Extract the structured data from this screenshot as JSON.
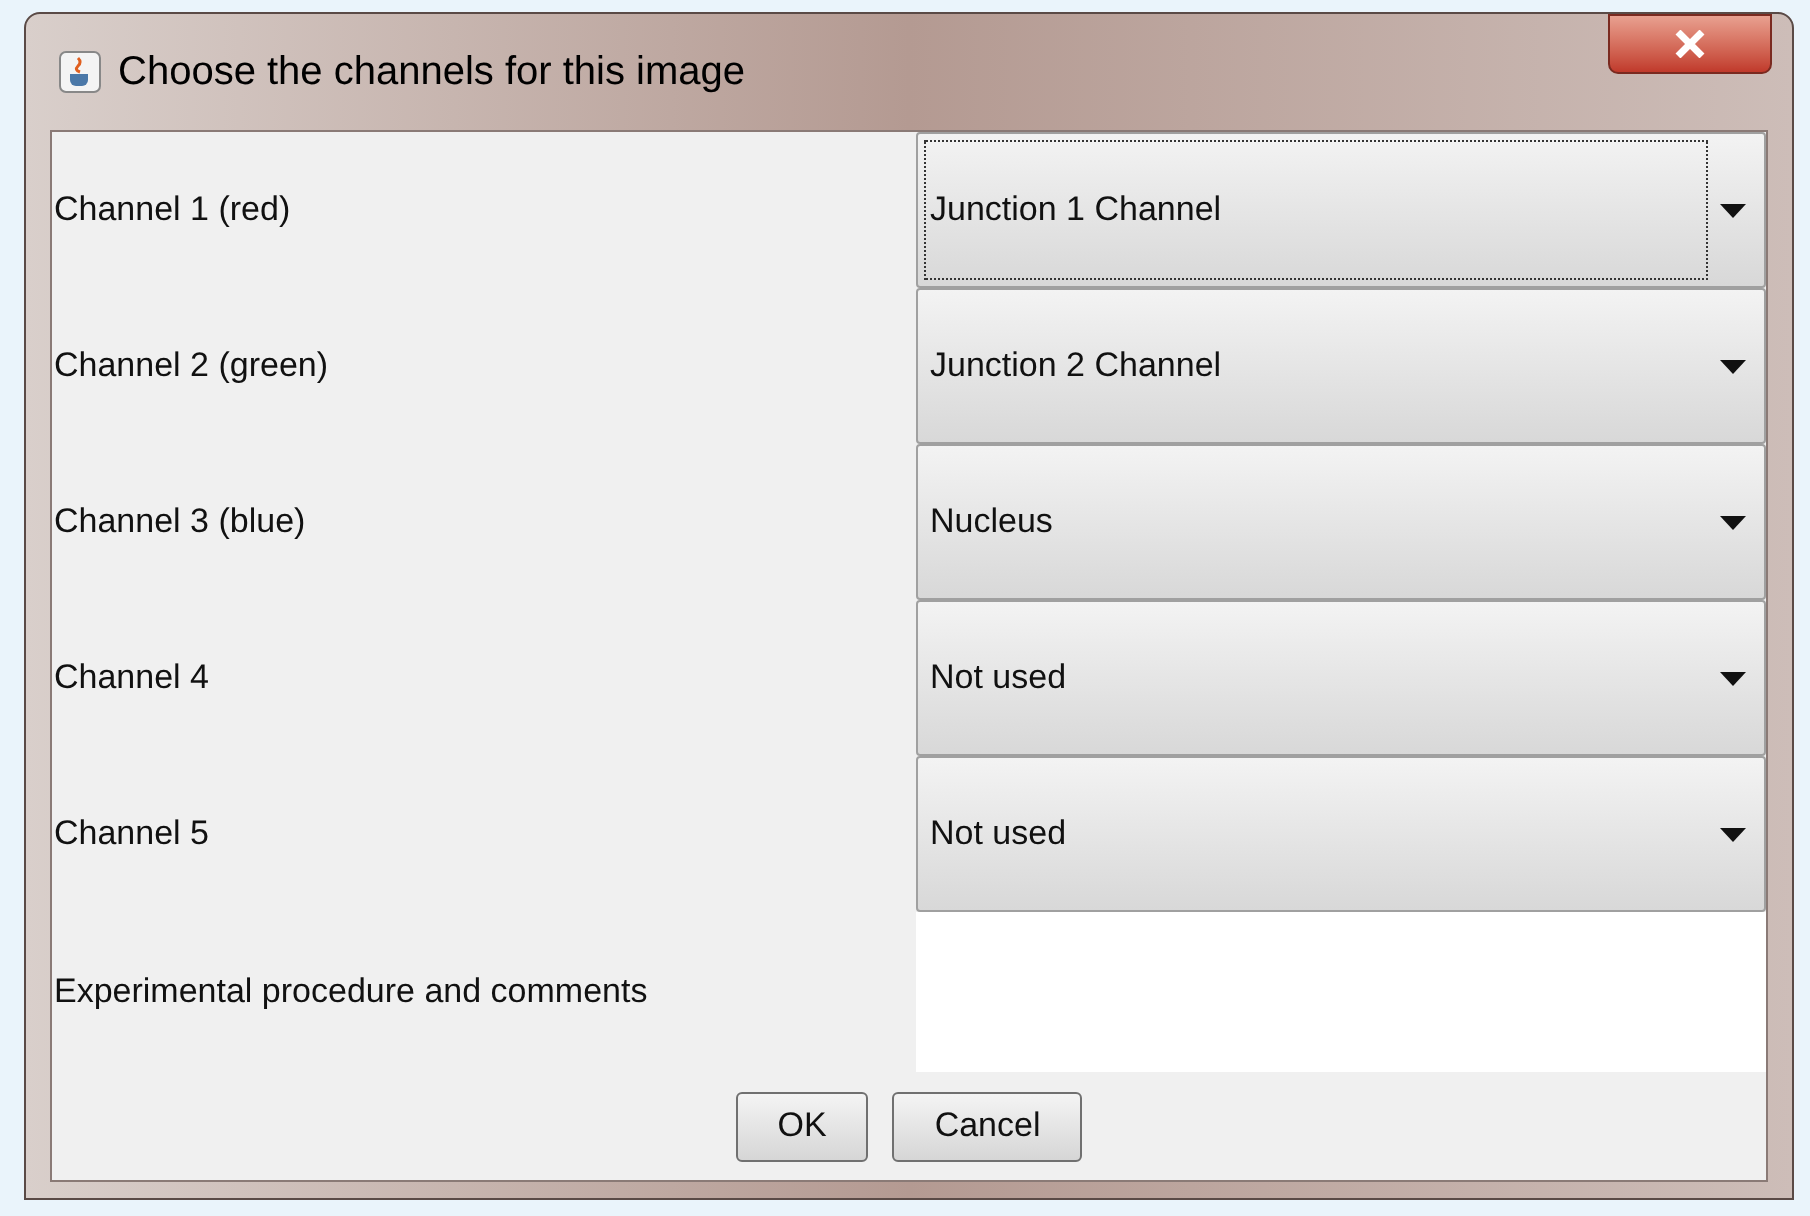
{
  "window": {
    "title": "Choose the channels for this image"
  },
  "channels": [
    {
      "label": "Channel 1 (red)",
      "value": "Junction 1 Channel",
      "focused": true
    },
    {
      "label": "Channel 2 (green)",
      "value": "Junction 2 Channel",
      "focused": false
    },
    {
      "label": "Channel 3 (blue)",
      "value": "Nucleus",
      "focused": false
    },
    {
      "label": "Channel 4",
      "value": "Not used",
      "focused": false
    },
    {
      "label": "Channel 5",
      "value": "Not used",
      "focused": false
    }
  ],
  "comments": {
    "label": "Experimental procedure and comments"
  },
  "buttons": [
    "OK",
    "Cancel"
  ]
}
